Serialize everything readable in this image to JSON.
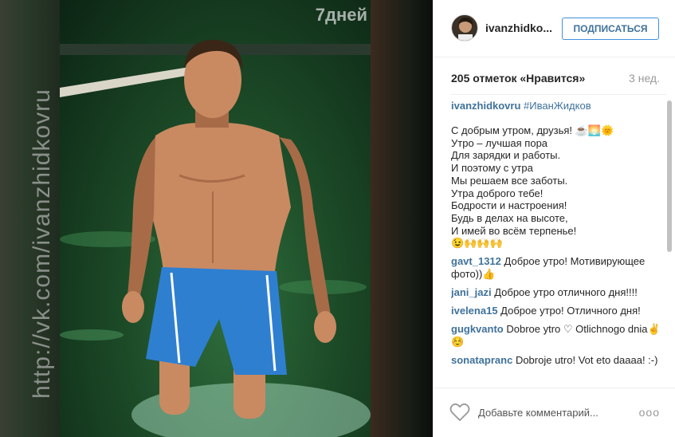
{
  "photo": {
    "watermark_side": "http://vk.com/ivanzhidkovru",
    "watermark_top": "7дней"
  },
  "header": {
    "username": "ivanzhidko...",
    "follow_label": "ПОДПИСАТЬСЯ"
  },
  "meta": {
    "likes": "205 отметок «Нравится»",
    "time": "3 нед."
  },
  "caption": {
    "user": "ivanzhidkovru",
    "hashtag": "#ИванЖидков",
    "lines": [
      "С добрым утром, друзья! ☕🌅🌞",
      "Утро – лучшая пора",
      "Для зарядки и работы.",
      "И поэтому с утра",
      "Мы решаем все заботы.",
      "Утра доброго тебе!",
      "Бодрости и настроения!",
      "Будь в делах на высоте,",
      "И имей во всём терпенье!",
      "😉🙌🙌🙌"
    ]
  },
  "comments": [
    {
      "user": "gavt_1312",
      "text": "Доброе утро! Мотивирующее фото))👍"
    },
    {
      "user": "jani_jazi",
      "text": "Доброе утро отличного дня!!!!"
    },
    {
      "user": "ivelena15",
      "text": "Доброе утро! Отличного дня!"
    },
    {
      "user": "gugkvanto",
      "text": "Dobroe ytro ♡ Otlichnogo dnia✌️☺️"
    },
    {
      "user": "sonatapranc",
      "text": "Dobroje utro! Vot eto daaaa! :-)"
    }
  ],
  "comment_bar": {
    "placeholder": "Добавьте комментарий...",
    "more": "ooo"
  },
  "colors": {
    "link": "#3f729b",
    "follow_border": "#4090db"
  }
}
